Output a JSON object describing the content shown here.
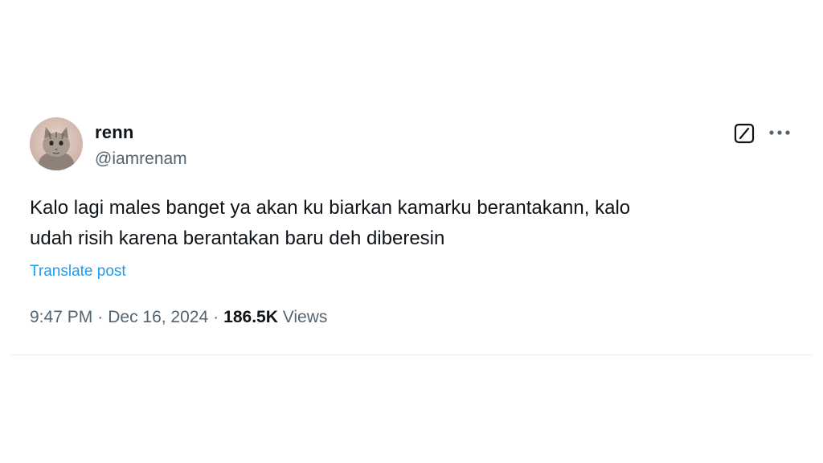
{
  "tweet": {
    "author": {
      "display_name": "renn",
      "handle": "@iamrenam",
      "avatar_icon": "cat-avatar"
    },
    "actions": {
      "grok_icon": "grok-icon",
      "more_icon": "more-options-icon"
    },
    "text_lines": [
      "Kalo lagi males banget ya akan ku biarkan kamarku berantakann, kalo",
      "udah risih karena berantakan baru deh diberesin"
    ],
    "translate_label": "Translate post",
    "meta": {
      "time": "9:47 PM",
      "date": "Dec 16, 2024",
      "separator": "·",
      "views_count": "186.5K",
      "views_label": "Views"
    }
  },
  "colors": {
    "text_primary": "#0f1419",
    "text_secondary": "#536471",
    "link": "#1d9bf0"
  }
}
